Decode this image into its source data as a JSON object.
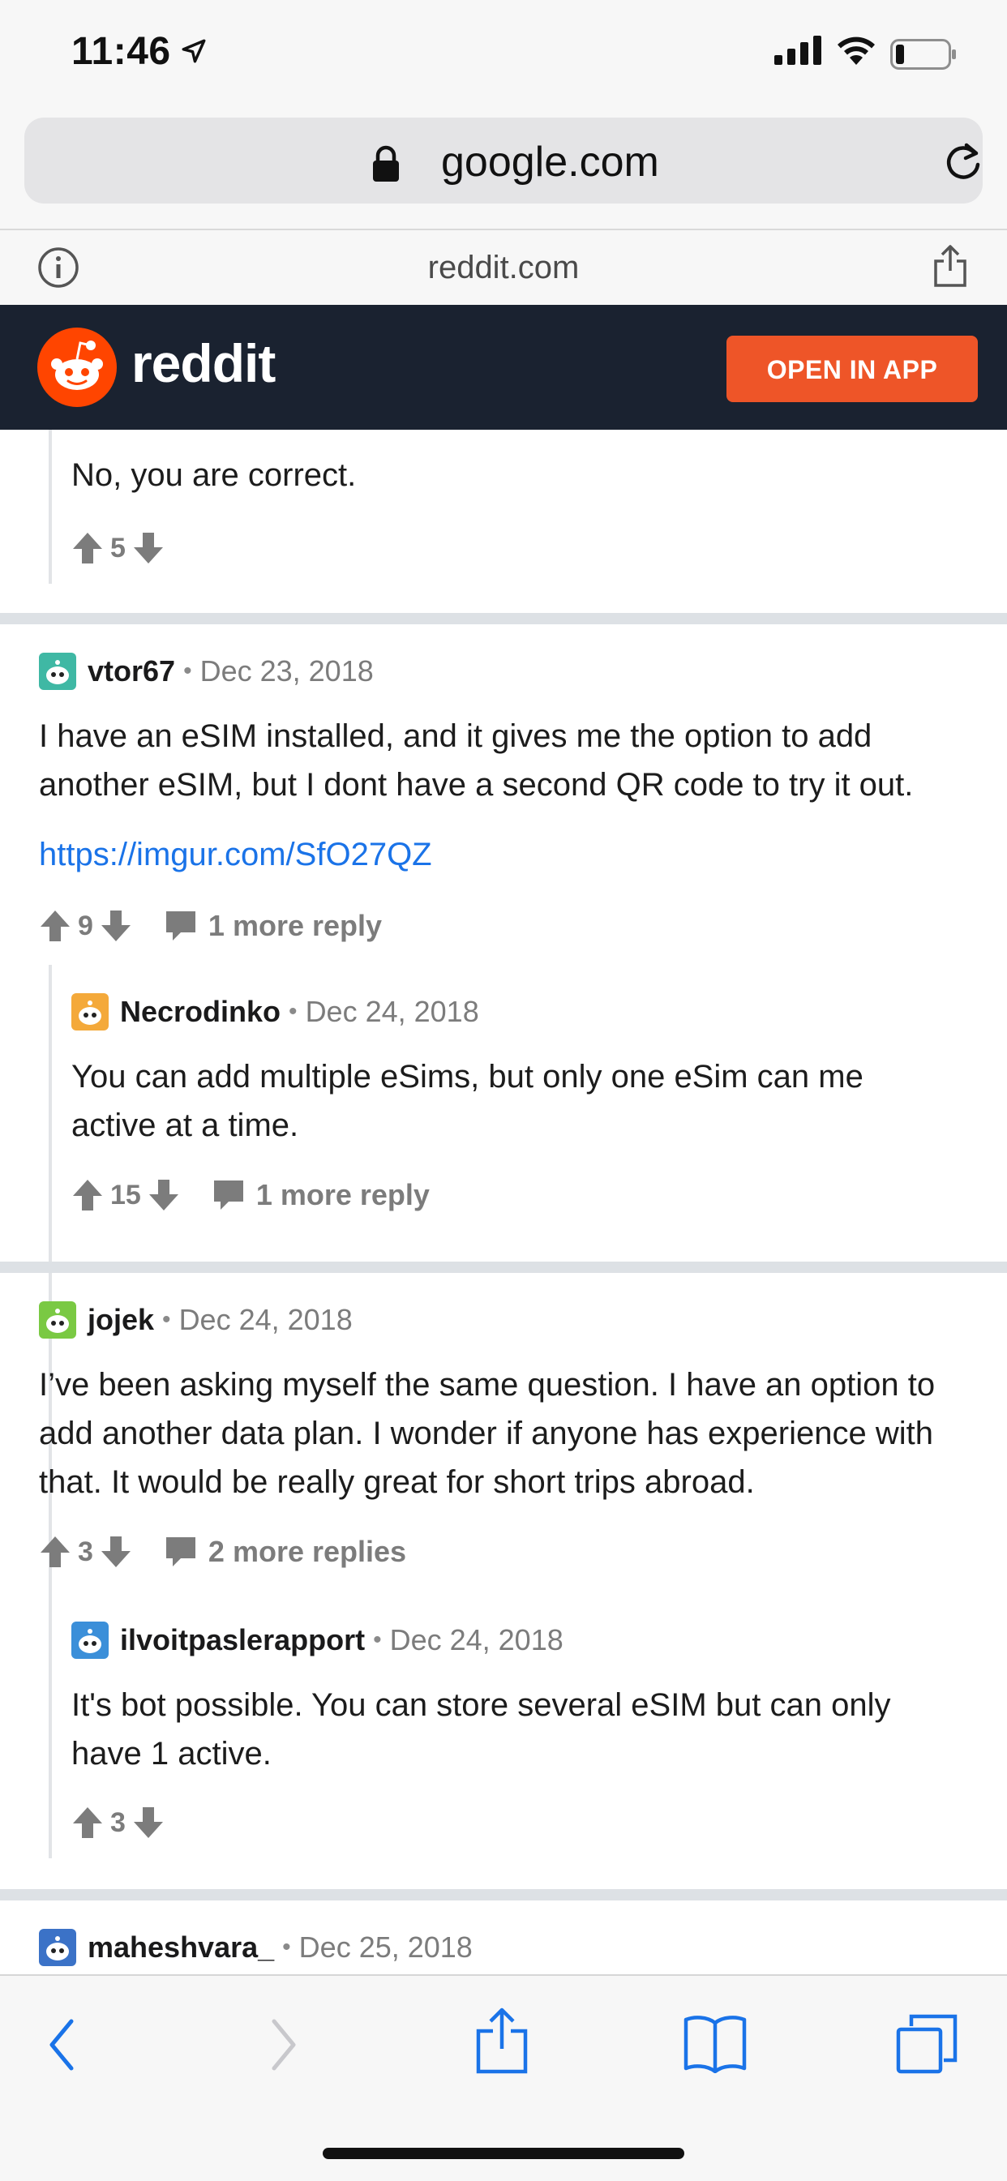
{
  "status": {
    "time": "11:46"
  },
  "browser": {
    "url": "google.com",
    "inner_url": "reddit.com"
  },
  "header": {
    "brand": "reddit",
    "open_in_app": "OPEN IN APP"
  },
  "comments": [
    {
      "text": "No, you are correct.",
      "votes": "5"
    },
    {
      "user": "vtor67",
      "date": "Dec 23, 2018",
      "text": "I have an eSIM installed, and it gives me the option to add another eSIM, but I dont have a second QR code to try it out.",
      "link": "https://imgur.com/SfO27QZ",
      "votes": "9",
      "replies": "1 more reply",
      "avatar_color": "#3fb8a4"
    },
    {
      "user": "Necrodinko",
      "date": "Dec 24, 2018",
      "text": "You can add multiple eSims, but only one eSim can me active at a time.",
      "votes": "15",
      "replies": "1 more reply",
      "avatar_color": "#f4a93a"
    },
    {
      "user": "jojek",
      "date": "Dec 24, 2018",
      "text": "I’ve been asking myself the same question. I have an option to add another data plan. I wonder if anyone has experience with that. It would be really great for short trips abroad.",
      "votes": "3",
      "replies": "2 more replies",
      "avatar_color": "#7ac943"
    },
    {
      "user": "ilvoitpaslerapport",
      "date": "Dec 24, 2018",
      "text": "It's bot possible. You can store several eSIM but can only have 1 active.",
      "votes": "3",
      "avatar_color": "#3b8fd9"
    },
    {
      "user": "maheshvara_",
      "date": "Dec 25, 2018",
      "avatar_color": "#3b72c7"
    }
  ],
  "colors": {
    "accent": "#ee5528",
    "header_bg": "#1a2230",
    "link": "#1a73e8"
  }
}
